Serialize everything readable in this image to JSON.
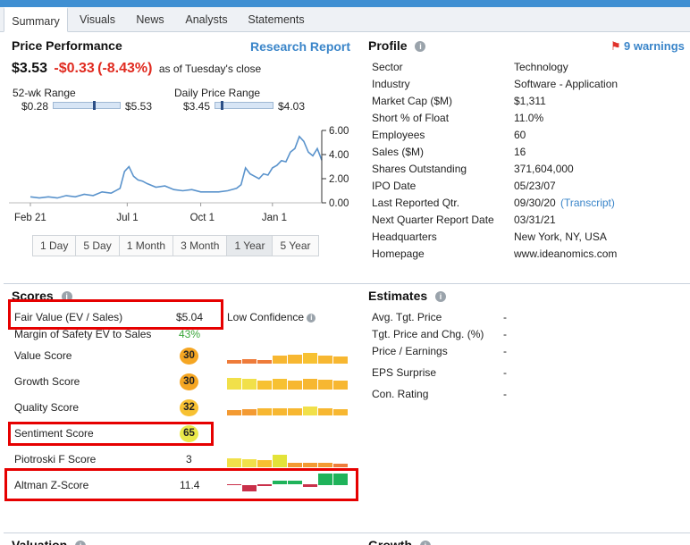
{
  "tabs": [
    "Summary",
    "Visuals",
    "News",
    "Analysts",
    "Statements"
  ],
  "price_performance": {
    "title": "Price Performance",
    "research_link": "Research Report",
    "price": "$3.53",
    "change": "-$0.33",
    "change_pct_open": "(",
    "change_pct": "-8.43%",
    "change_pct_close": ")",
    "as_of": "as of Tuesday's close",
    "wk52_label": "52-wk Range",
    "wk52_low": "$0.28",
    "wk52_high": "$5.53",
    "daily_label": "Daily Price Range",
    "daily_low": "$3.45",
    "daily_high": "$4.03",
    "periods": [
      "1 Day",
      "5 Day",
      "1 Month",
      "3 Month",
      "1 Year",
      "5 Year"
    ],
    "selected_period": "1 Year"
  },
  "chart_data": {
    "type": "line",
    "x_ticks": [
      "Feb 21",
      "Jul 1",
      "Oct 1",
      "Jan 1"
    ],
    "y_ticks": [
      "0.00",
      "2.00",
      "4.00",
      "6.00"
    ],
    "ylim": [
      0,
      6
    ],
    "x": [
      0,
      10,
      20,
      30,
      40,
      50,
      60,
      70,
      80,
      90,
      100,
      105,
      110,
      115,
      120,
      125,
      130,
      140,
      150,
      160,
      170,
      180,
      190,
      200,
      210,
      220,
      230,
      235,
      240,
      245,
      250,
      255,
      260,
      265,
      270,
      275,
      280,
      285,
      290,
      295,
      300,
      305,
      310,
      315,
      320,
      325
    ],
    "values": [
      0.5,
      0.4,
      0.5,
      0.4,
      0.6,
      0.5,
      0.7,
      0.6,
      0.9,
      0.8,
      1.2,
      2.6,
      3.0,
      2.2,
      1.9,
      1.8,
      1.6,
      1.3,
      1.4,
      1.1,
      1.0,
      1.1,
      0.9,
      0.9,
      0.9,
      1.0,
      1.2,
      1.5,
      2.9,
      2.4,
      2.2,
      2.0,
      2.4,
      2.3,
      2.9,
      3.1,
      3.5,
      3.4,
      4.2,
      4.5,
      5.5,
      5.1,
      4.2,
      3.9,
      4.5,
      3.53
    ]
  },
  "profile": {
    "title": "Profile",
    "warnings": "9 warnings",
    "rows": [
      {
        "label": "Sector",
        "value": "Technology"
      },
      {
        "label": "Industry",
        "value": "Software - Application"
      },
      {
        "label": "Market Cap ($M)",
        "value": "$1,311"
      },
      {
        "label": "Short % of Float",
        "value": "11.0%"
      },
      {
        "label": "Employees",
        "value": "60"
      },
      {
        "label": "Sales ($M)",
        "value": "16"
      },
      {
        "label": "Shares Outstanding",
        "value": "371,604,000"
      },
      {
        "label": "IPO Date",
        "value": "05/23/07"
      },
      {
        "label": "Last Reported Qtr.",
        "value": "09/30/20",
        "extra": "(Transcript)"
      },
      {
        "label": "Next Quarter Report Date",
        "value": "03/31/21"
      },
      {
        "label": "Headquarters",
        "value": "New York, NY, USA"
      },
      {
        "label": "Homepage",
        "value": "www.ideanomics.com"
      }
    ]
  },
  "scores": {
    "title": "Scores",
    "fair_value_label": "Fair Value (EV / Sales)",
    "fair_value": "$5.04",
    "confidence": "Low Confidence",
    "margin_label": "Margin of Safety EV to Sales",
    "margin_value": "43%",
    "rows": [
      {
        "label": "Value Score",
        "value": "30",
        "color": "#f5a623"
      },
      {
        "label": "Growth Score",
        "value": "30",
        "color": "#f5a623"
      },
      {
        "label": "Quality Score",
        "value": "32",
        "color": "#f7c132"
      },
      {
        "label": "Sentiment Score",
        "value": "65",
        "color": "#e9e84a"
      },
      {
        "label": "Piotroski F Score",
        "value": "3"
      },
      {
        "label": "Altman Z-Score",
        "value": "11.4"
      }
    ]
  },
  "estimates": {
    "title": "Estimates",
    "rows": [
      {
        "label": "Avg. Tgt. Price",
        "value": "-"
      },
      {
        "label": "Tgt. Price and Chg. (%)",
        "value": "-"
      },
      {
        "label": "Price / Earnings",
        "value": "-"
      },
      {
        "label": "EPS Surprise",
        "value": "-"
      },
      {
        "label": "Con. Rating",
        "value": "-"
      }
    ]
  },
  "bottom": {
    "valuation": "Valuation",
    "growth": "Growth"
  },
  "colors": {
    "accent_blue": "#3a85c9",
    "negative_red": "#e02b20",
    "highlight_box": "#e60000",
    "positive_green": "#3aa63a"
  }
}
